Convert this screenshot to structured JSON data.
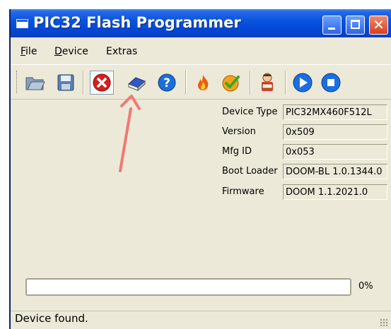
{
  "window": {
    "title": "PIC32 Flash Programmer",
    "title_bar_color": "#0a54e0",
    "close_button_color": "#d6401e"
  },
  "menu": {
    "items": [
      {
        "mnemonic": "F",
        "rest": "ile"
      },
      {
        "mnemonic": "D",
        "rest": "evice"
      },
      {
        "mnemonic": "",
        "rest": "Extras"
      }
    ]
  },
  "toolbar": {
    "icons": [
      "open-folder-icon",
      "save-icon",
      "stop-icon",
      "eraser-icon",
      "help-icon",
      "fire-icon",
      "checkmark-icon",
      "person-reading-icon",
      "play-icon",
      "stop-circle-icon"
    ],
    "pressed": "stop-icon"
  },
  "device_info": [
    {
      "label": "Device Type",
      "value": "PIC32MX460F512L"
    },
    {
      "label": "Version",
      "value": "0x509"
    },
    {
      "label": "Mfg ID",
      "value": "0x053"
    },
    {
      "label": "Boot Loader",
      "value": "DOOM-BL 1.0.1344.0"
    },
    {
      "label": "Firmware",
      "value": "DOOM 1.1.2021.0"
    }
  ],
  "progress": {
    "value": 0,
    "label": "0%"
  },
  "status": {
    "text": "Device found."
  },
  "annotation": {
    "arrow_color": "#f07a72",
    "points_to": "eraser-icon"
  }
}
